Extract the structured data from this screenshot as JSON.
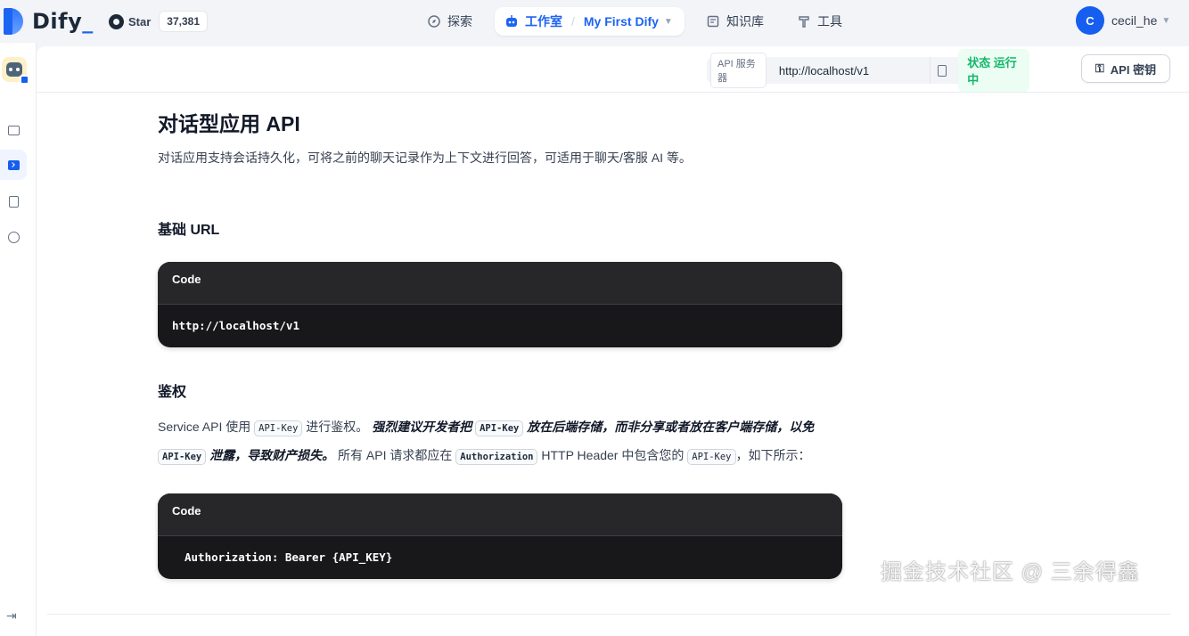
{
  "brand": {
    "name": "Dify",
    "accent": "#1c64f2"
  },
  "github": {
    "label": "Star",
    "count": "37,381",
    "icon": "github-icon"
  },
  "nav": {
    "explore": "探索",
    "studio": "工作室",
    "app_name": "My First Dify",
    "datasets": "知识库",
    "tools": "工具"
  },
  "user": {
    "initial": "C",
    "name": "cecil_he"
  },
  "api_bar": {
    "server_label": "API 服务器",
    "server_url": "http://localhost/v1",
    "status": "状态 运行中",
    "key_button": "API 密钥"
  },
  "doc": {
    "title": "对话型应用 API",
    "lead": "对话应用支持会话持久化，可将之前的聊天记录作为上下文进行回答，可适用于聊天/客服 AI 等。",
    "base_heading": "基础 URL",
    "code_label": "Code",
    "base_code": "http://localhost/v1",
    "auth_heading": "鉴权",
    "auth_p": {
      "t1": "Service API 使用 ",
      "c1": "API-Key",
      "t2": " 进行鉴权。 ",
      "e1": "强烈建议开发者把 ",
      "c2": "API-Key",
      "e2": " 放在后端存储，而非分享或者放在客户端存储，以免",
      "c3": "API-Key",
      "e3": " 泄露，导致财产损失。",
      "t3": " 所有 API 请求都应在 ",
      "c4": "Authorization",
      "t4": " HTTP Header 中包含您的 ",
      "c5": "API-Key",
      "t5": "，如下所示："
    },
    "auth_code": "Authorization: Bearer {API_KEY}"
  },
  "watermark": "掘金技术社区 @ 三余得鑫"
}
